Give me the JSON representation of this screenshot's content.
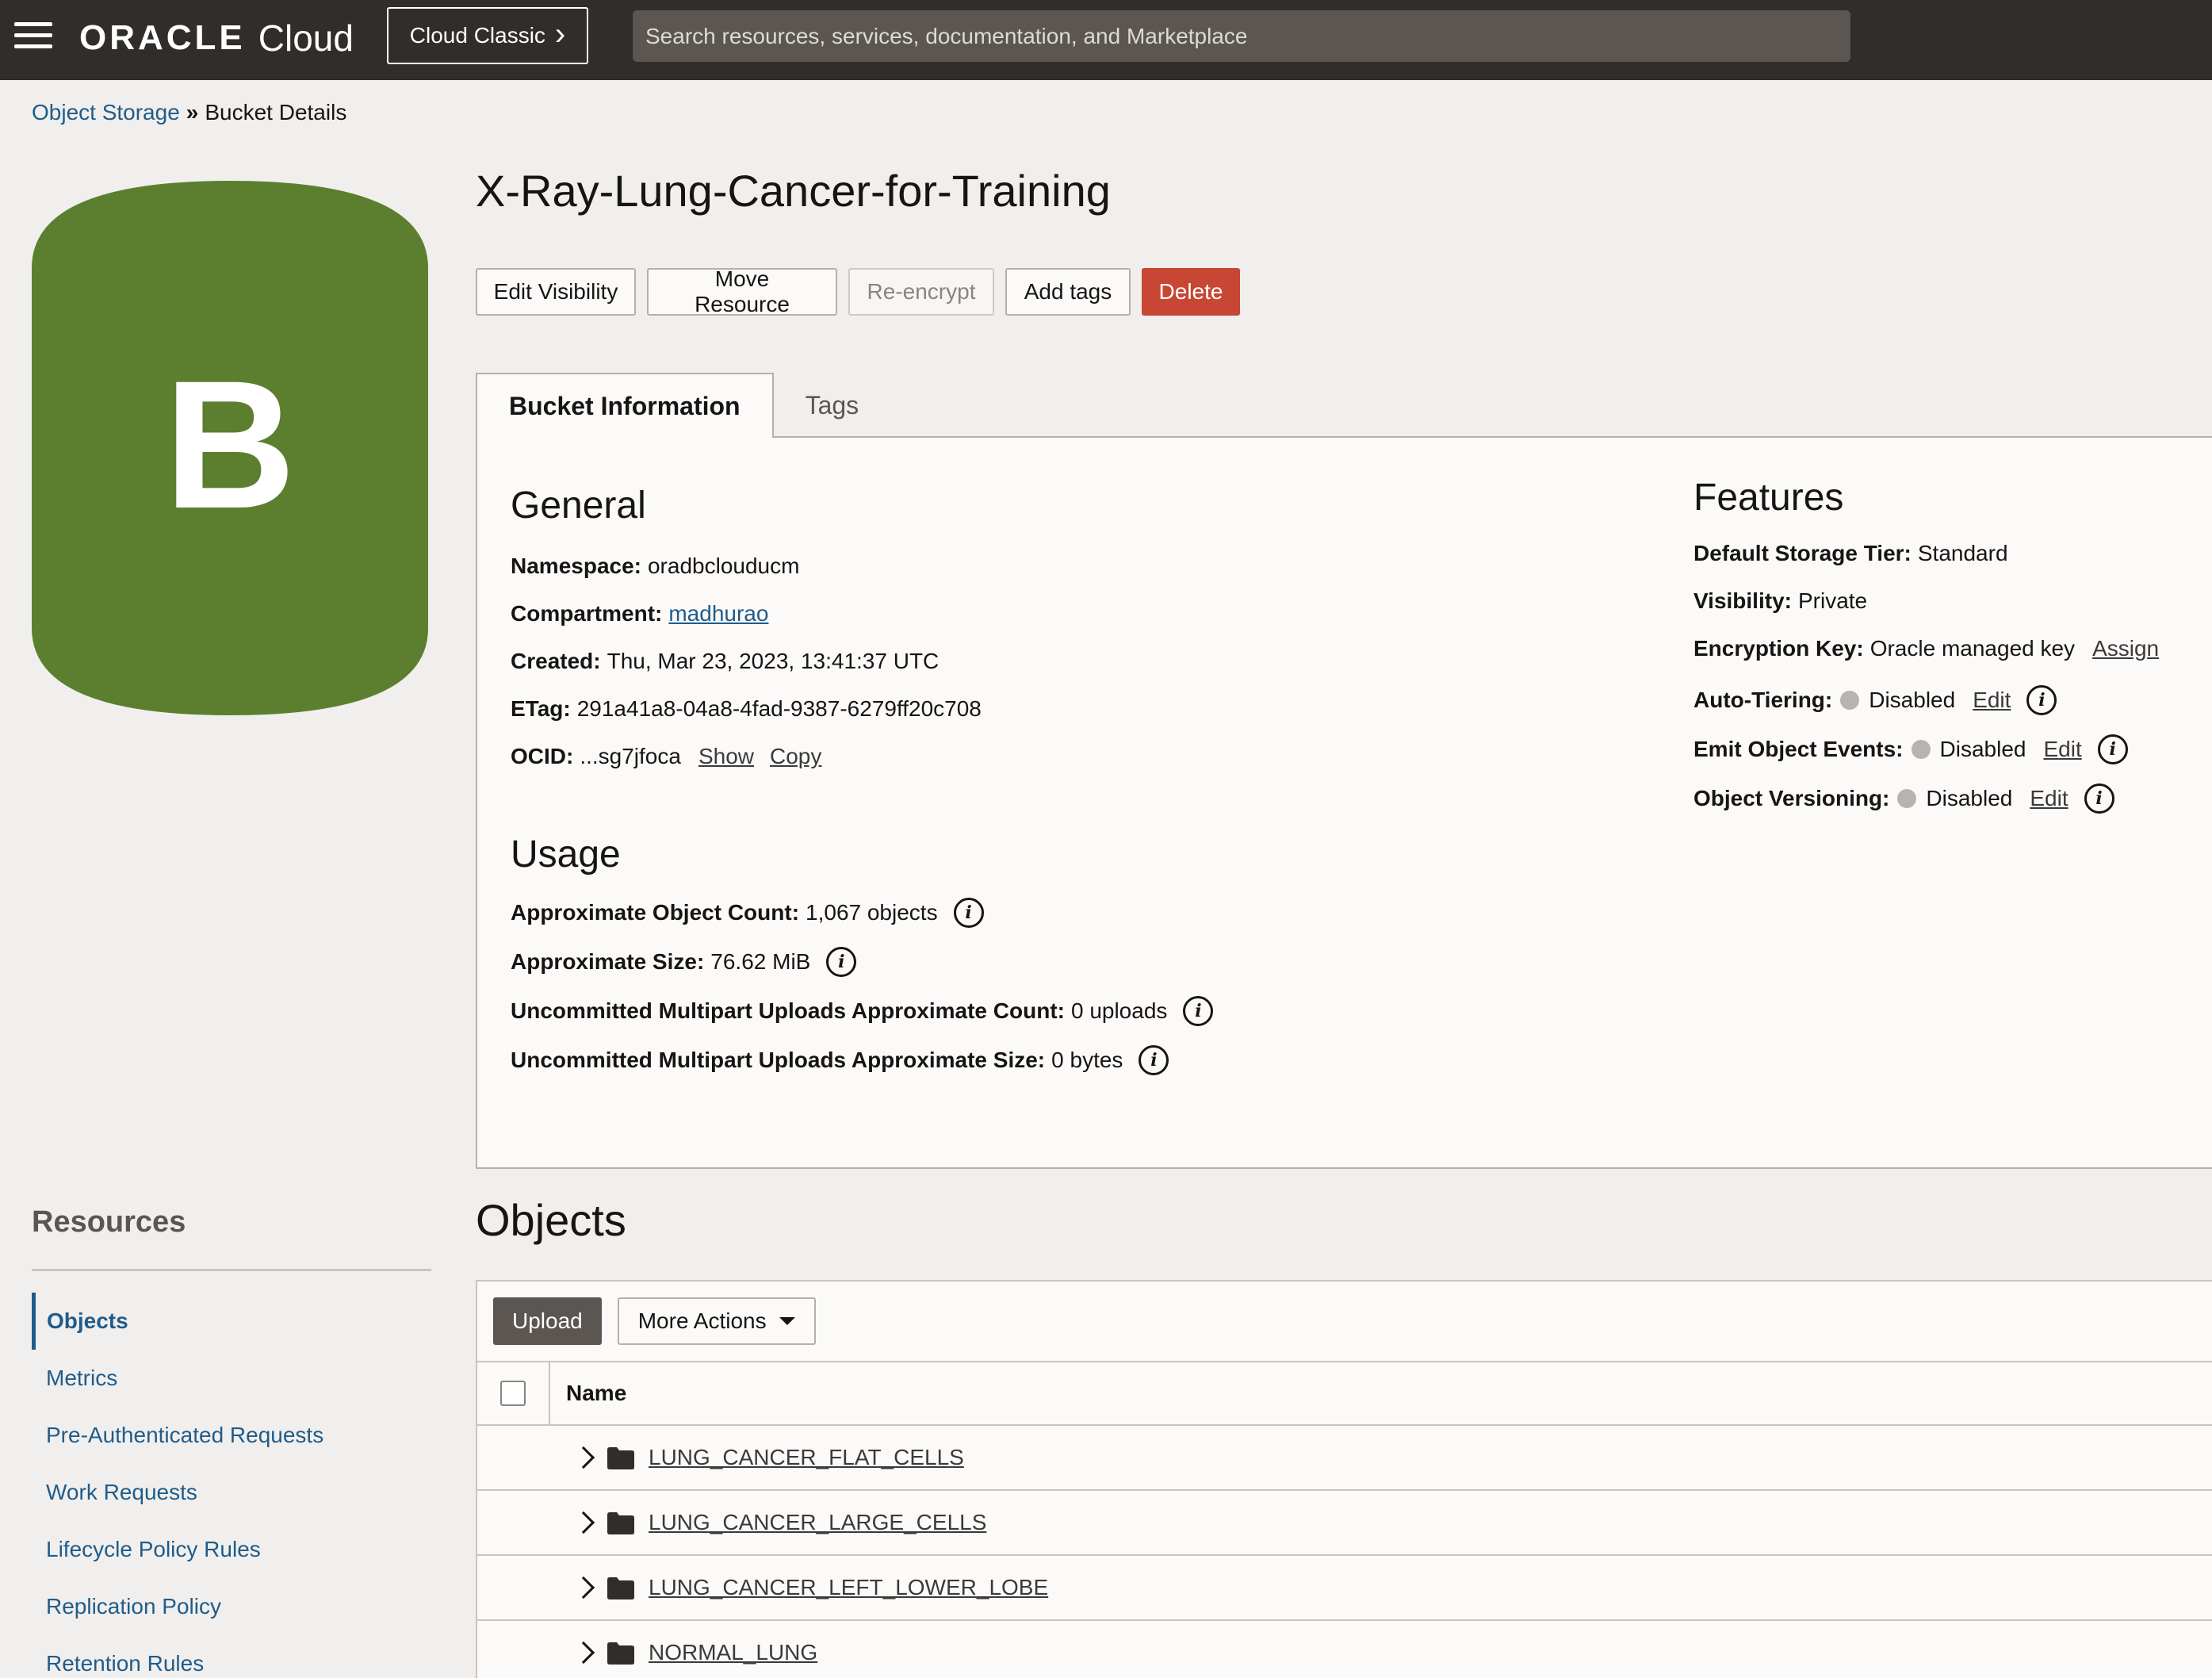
{
  "header": {
    "brand_oracle": "ORACLE",
    "brand_cloud": "Cloud",
    "cloud_classic_label": "Cloud Classic",
    "cloud_classic_chevron": "›",
    "search_placeholder": "Search resources, services, documentation, and Marketplace"
  },
  "breadcrumb": {
    "parent": "Object Storage",
    "separator": "»",
    "current": "Bucket Details"
  },
  "bucket_icon": {
    "letter": "B",
    "color": "#5b7f2f"
  },
  "title": "X-Ray-Lung-Cancer-for-Training",
  "actions": {
    "edit_visibility": "Edit Visibility",
    "move_resource": "Move Resource",
    "re_encrypt": "Re-encrypt",
    "add_tags": "Add tags",
    "delete": "Delete"
  },
  "tabs": {
    "bucket_information": "Bucket Information",
    "tags": "Tags"
  },
  "general": {
    "heading": "General",
    "namespace_label": "Namespace:",
    "namespace_value": "oradbclouducm",
    "compartment_label": "Compartment:",
    "compartment_value": "madhurao",
    "created_label": "Created:",
    "created_value": "Thu, Mar 23, 2023, 13:41:37 UTC",
    "etag_label": "ETag:",
    "etag_value": "291a41a8-04a8-4fad-9387-6279ff20c708",
    "ocid_label": "OCID:",
    "ocid_value": "...sg7jfoca",
    "ocid_show": "Show",
    "ocid_copy": "Copy"
  },
  "usage": {
    "heading": "Usage",
    "object_count_label": "Approximate Object Count:",
    "object_count_value": "1,067 objects",
    "size_label": "Approximate Size:",
    "size_value": "76.62 MiB",
    "multipart_count_label": "Uncommitted Multipart Uploads Approximate Count:",
    "multipart_count_value": "0 uploads",
    "multipart_size_label": "Uncommitted Multipart Uploads Approximate Size:",
    "multipart_size_value": "0 bytes",
    "info_glyph": "i"
  },
  "features": {
    "heading": "Features",
    "storage_tier_label": "Default Storage Tier:",
    "storage_tier_value": "Standard",
    "visibility_label": "Visibility:",
    "visibility_value": "Private",
    "encryption_label": "Encryption Key:",
    "encryption_value": "Oracle managed key",
    "encryption_assign": "Assign",
    "auto_tiering_label": "Auto-Tiering:",
    "auto_tiering_value": "Disabled",
    "emit_events_label": "Emit Object Events:",
    "emit_events_value": "Disabled",
    "versioning_label": "Object Versioning:",
    "versioning_value": "Disabled",
    "edit_label": "Edit"
  },
  "resources": {
    "heading": "Resources",
    "items": [
      "Objects",
      "Metrics",
      "Pre-Authenticated Requests",
      "Work Requests",
      "Lifecycle Policy Rules",
      "Replication Policy",
      "Retention Rules"
    ]
  },
  "objects": {
    "heading": "Objects",
    "upload": "Upload",
    "more_actions": "More Actions",
    "column_name": "Name",
    "rows": [
      "LUNG_CANCER_FLAT_CELLS",
      "LUNG_CANCER_LARGE_CELLS",
      "LUNG_CANCER_LEFT_LOWER_LOBE",
      "NORMAL_LUNG"
    ]
  }
}
